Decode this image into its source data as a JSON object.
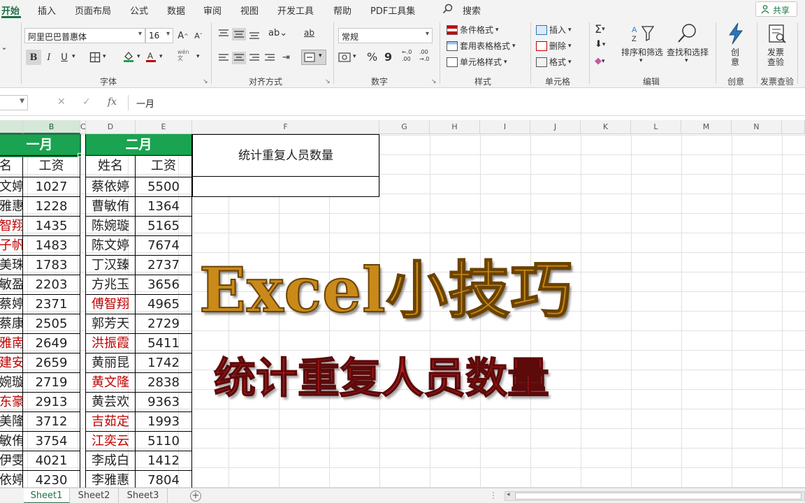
{
  "ribbon_tabs": [
    "开始",
    "插入",
    "页面布局",
    "公式",
    "数据",
    "审阅",
    "视图",
    "开发工具",
    "帮助",
    "PDF工具集"
  ],
  "search_label": "搜索",
  "share_label": "共享",
  "font": {
    "name": "阿里巴巴普惠体",
    "size": "16",
    "grow": "A",
    "shrink": "A"
  },
  "format_buttons": {
    "bold": "B",
    "italic": "I",
    "underline": "U",
    "wen": "wén\n文"
  },
  "number_format": "常规",
  "number_symbols": {
    "percent": "%",
    "comma": "9",
    "inc_decimal": "←.0\n.00",
    "dec_decimal": ".00\n→.0"
  },
  "styles_group": [
    "条件格式",
    "套用表格格式",
    "单元格样式"
  ],
  "cells_group": [
    "插入",
    "删除",
    "格式"
  ],
  "edit_group": [
    "排序和筛选",
    "查找和选择"
  ],
  "create_btn": "创\n意",
  "invoice_btn": "发票\n查验",
  "group_labels": {
    "font": "字体",
    "align": "对齐方式",
    "number": "数字",
    "styles": "样式",
    "cells": "单元格",
    "edit": "编辑",
    "create": "创意",
    "invoice": "发票查验"
  },
  "formula_bar": {
    "fx": "fx",
    "content": "一月"
  },
  "columns": [
    "B",
    "C",
    "D",
    "E",
    "F",
    "G",
    "H",
    "I",
    "J",
    "K",
    "L",
    "M",
    "N"
  ],
  "jan": {
    "header": "一月",
    "col_name": "名",
    "col_salary": "工资",
    "rows": [
      {
        "name": "文婷",
        "salary": "1027",
        "red": false
      },
      {
        "name": "雅惠",
        "salary": "1228",
        "red": false
      },
      {
        "name": "智翔",
        "salary": "1435",
        "red": true
      },
      {
        "name": "子帆",
        "salary": "1483",
        "red": true
      },
      {
        "name": "美珠",
        "salary": "1783",
        "red": false
      },
      {
        "name": "敏盈",
        "salary": "2203",
        "red": false
      },
      {
        "name": "蔡婷",
        "salary": "2371",
        "red": false
      },
      {
        "name": "蔡康",
        "salary": "2505",
        "red": false
      },
      {
        "name": "雅南",
        "salary": "2649",
        "red": true
      },
      {
        "name": "建安",
        "salary": "2659",
        "red": true
      },
      {
        "name": "婉璇",
        "salary": "2719",
        "red": false
      },
      {
        "name": "东豪",
        "salary": "2913",
        "red": true
      },
      {
        "name": "美隆",
        "salary": "3712",
        "red": false
      },
      {
        "name": "敏侑",
        "salary": "3754",
        "red": false
      },
      {
        "name": "伊雯",
        "salary": "4021",
        "red": false
      },
      {
        "name": "依婷",
        "salary": "4230",
        "red": false
      }
    ]
  },
  "feb": {
    "header": "二月",
    "col_name": "姓名",
    "col_salary": "工资",
    "rows": [
      {
        "name": "蔡依婷",
        "salary": "5500",
        "red": false
      },
      {
        "name": "曹敏侑",
        "salary": "1364",
        "red": false
      },
      {
        "name": "陈婉璇",
        "salary": "5165",
        "red": false
      },
      {
        "name": "陈文婷",
        "salary": "7674",
        "red": false
      },
      {
        "name": "丁汉臻",
        "salary": "2737",
        "red": false
      },
      {
        "name": "方兆玉",
        "salary": "3656",
        "red": false
      },
      {
        "name": "傅智翔",
        "salary": "4965",
        "red": true
      },
      {
        "name": "郭芳天",
        "salary": "2729",
        "red": false
      },
      {
        "name": "洪振霞",
        "salary": "5411",
        "red": true
      },
      {
        "name": "黄丽昆",
        "salary": "1742",
        "red": false
      },
      {
        "name": "黄文隆",
        "salary": "2838",
        "red": true
      },
      {
        "name": "黄芸欢",
        "salary": "9363",
        "red": false
      },
      {
        "name": "吉茹定",
        "salary": "1993",
        "red": true
      },
      {
        "name": "江奕云",
        "salary": "5110",
        "red": true
      },
      {
        "name": "李成白",
        "salary": "1412",
        "red": false
      },
      {
        "name": "李雅惠",
        "salary": "7804",
        "red": false
      }
    ]
  },
  "stat_title": "统计重复人员数量",
  "overlay": {
    "main": "Excel小技巧",
    "sub": "统计重复人员数量"
  },
  "sheets": [
    "Sheet1",
    "Sheet2",
    "Sheet3"
  ],
  "colors": {
    "accent": "#1e7145",
    "header_fill": "#1aa350",
    "red_text": "#c00000",
    "overlay_main": "#c98a1a",
    "overlay_sub": "#b81b1b"
  }
}
